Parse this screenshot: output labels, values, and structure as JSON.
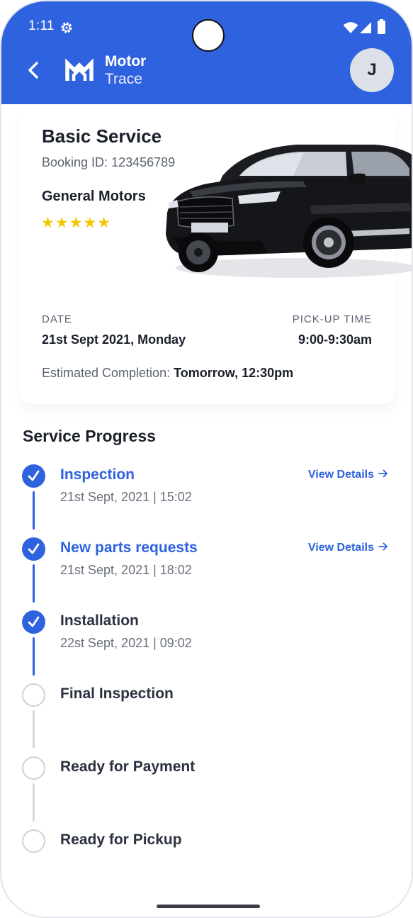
{
  "status_bar": {
    "time": "1:11"
  },
  "app": {
    "name_line1": "Motor",
    "name_line2": "Trace",
    "avatar_initial": "J"
  },
  "service": {
    "title": "Basic Service",
    "booking_label": "Booking ID:",
    "booking_id": "123456789",
    "manufacturer": "General Motors",
    "rating_stars": "★★★★★",
    "rating_value": 5,
    "date_label": "DATE",
    "date_value": "21st Sept 2021, Monday",
    "pickup_label": "PICK-UP TIME",
    "pickup_value": "9:00-9:30am",
    "completion_label": "Estimated Completion:",
    "completion_value": "Tomorrow, 12:30pm"
  },
  "progress": {
    "title": "Service Progress",
    "view_details_label": "View Details",
    "steps": [
      {
        "title": "Inspection",
        "time": "21st Sept, 2021 | 15:02",
        "status": "done"
      },
      {
        "title": "New parts requests",
        "time": "21st Sept, 2021 | 18:02",
        "status": "done"
      },
      {
        "title": "Installation",
        "time": "22st Sept, 2021 | 09:02",
        "status": "done"
      },
      {
        "title": "Final Inspection",
        "status": "pending"
      },
      {
        "title": "Ready for Payment",
        "status": "pending"
      },
      {
        "title": "Ready for Pickup",
        "status": "pending"
      }
    ]
  },
  "colors": {
    "primary": "#2f62de",
    "star": "#f2c700",
    "pending": "#cdd1d9"
  }
}
